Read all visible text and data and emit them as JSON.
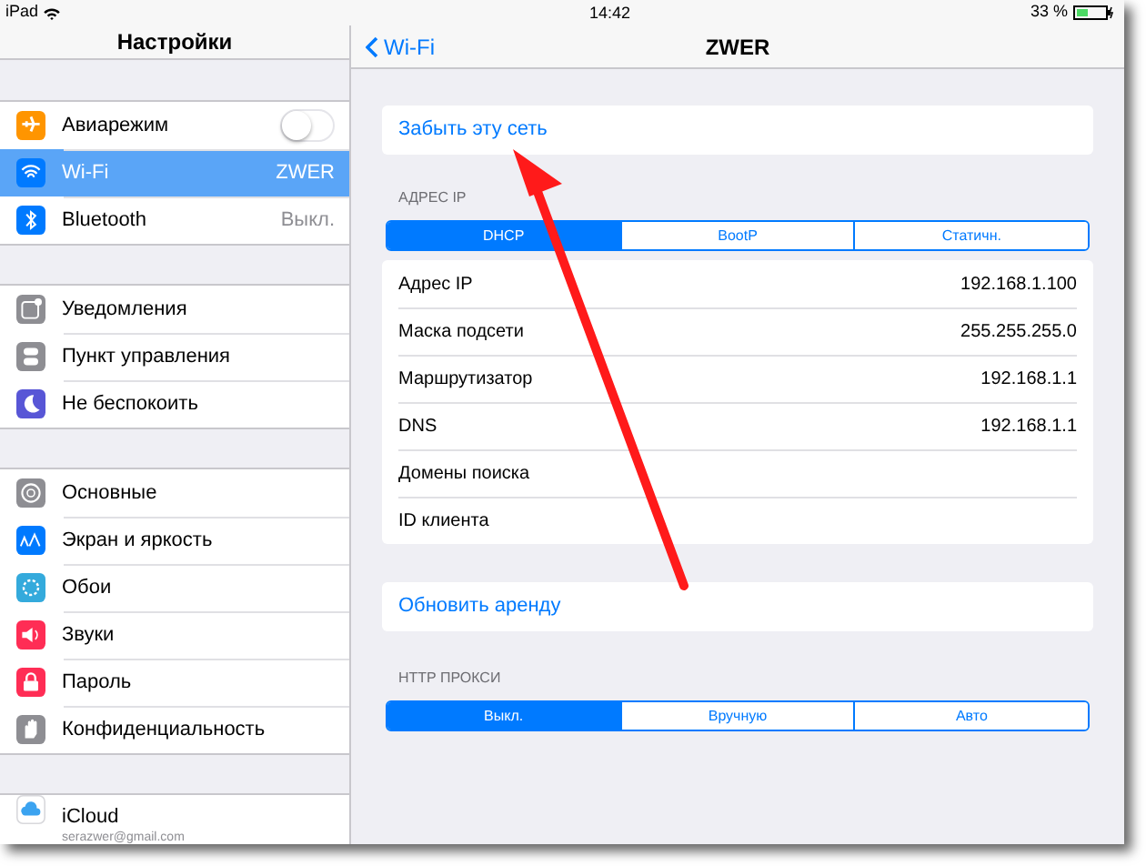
{
  "status_bar": {
    "device": "iPad",
    "time": "14:42",
    "battery": "33 %"
  },
  "sidebar": {
    "title": "Настройки",
    "groups": [
      [
        {
          "label": "Авиарежим",
          "kind": "toggle",
          "on": false,
          "color": "#ff9500",
          "selected": false
        },
        {
          "label": "Wi-Fi",
          "kind": "value",
          "value": "ZWER",
          "color": "#007aff",
          "selected": true
        },
        {
          "label": "Bluetooth",
          "kind": "value",
          "value": "Выкл.",
          "color": "#007aff",
          "selected": false
        }
      ],
      [
        {
          "label": "Уведомления",
          "kind": "plain",
          "color": "#8e8e93",
          "selected": false
        },
        {
          "label": "Пункт управления",
          "kind": "plain",
          "color": "#8e8e93",
          "selected": false
        },
        {
          "label": "Не беспокоить",
          "kind": "plain",
          "color": "#5856d6",
          "selected": false
        }
      ],
      [
        {
          "label": "Основные",
          "kind": "plain",
          "color": "#8e8e93",
          "selected": false
        },
        {
          "label": "Экран и яркость",
          "kind": "plain",
          "color": "#007aff",
          "selected": false
        },
        {
          "label": "Обои",
          "kind": "plain",
          "color": "#34aadc",
          "selected": false
        },
        {
          "label": "Звуки",
          "kind": "plain",
          "color": "#ff2d55",
          "selected": false
        },
        {
          "label": "Пароль",
          "kind": "plain",
          "color": "#ff2d55",
          "selected": false
        },
        {
          "label": "Конфиденциальность",
          "kind": "plain",
          "color": "#8e8e93",
          "selected": false
        }
      ],
      [
        {
          "label": "iCloud",
          "kind": "account",
          "value": "serazwer@gmail.com",
          "selected": false
        }
      ]
    ]
  },
  "detail": {
    "back": "Wi-Fi",
    "title": "ZWER",
    "forget": "Забыть эту сеть",
    "ip_header": "АДРЕС IP",
    "ip_modes": [
      {
        "label": "DHCP",
        "selected": true
      },
      {
        "label": "BootP",
        "selected": false
      },
      {
        "label": "Статичн.",
        "selected": false
      }
    ],
    "ip_rows": [
      {
        "label": "Адрес IP",
        "value": "192.168.1.100"
      },
      {
        "label": "Маска подсети",
        "value": "255.255.255.0"
      },
      {
        "label": "Маршрутизатор",
        "value": "192.168.1.1"
      },
      {
        "label": "DNS",
        "value": "192.168.1.1"
      },
      {
        "label": "Домены поиска"
      },
      {
        "label": "ID клиента"
      }
    ],
    "renew": "Обновить аренду",
    "proxy_header": "HTTP ПРОКСИ",
    "proxy_modes": [
      {
        "label": "Выкл.",
        "selected": true
      },
      {
        "label": "Вручную",
        "selected": false
      },
      {
        "label": "Авто",
        "selected": false
      }
    ]
  }
}
